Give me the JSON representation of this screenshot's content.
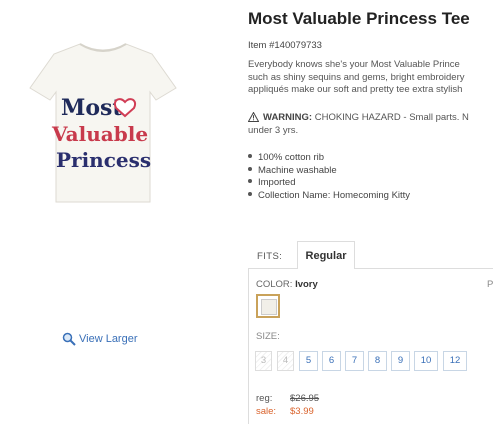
{
  "product": {
    "title": "Most Valuable Princess Tee",
    "item_number": "Item #140079733",
    "description_lines": [
      "Everybody knows she's your Most Valuable Prince",
      "such as shiny sequins and gems, bright embroidery",
      "appliqués make our soft and pretty tee extra stylish"
    ],
    "warning_label": "WARNING:",
    "warning_text": "CHOKING HAZARD - Small parts. N",
    "warning_text_2": "under 3 yrs.",
    "features": [
      "100% cotton rib",
      "Machine washable",
      "Imported",
      "Collection Name: Homecoming Kitty"
    ],
    "image_text": {
      "line1": "Most",
      "line2": "Valuable",
      "line3": "Princess"
    }
  },
  "view_larger": {
    "label": "View Larger",
    "icon": "magnifier-icon"
  },
  "fits": {
    "label": "FITS:",
    "tabs": [
      "Regular"
    ]
  },
  "color": {
    "label": "COLOR:",
    "value": "Ivory",
    "swatch_color": "#f1efe8",
    "cut_text": "P"
  },
  "size": {
    "label": "SIZE:",
    "options": [
      {
        "label": "3",
        "available": false
      },
      {
        "label": "4",
        "available": false
      },
      {
        "label": "5",
        "available": true
      },
      {
        "label": "6",
        "available": true
      },
      {
        "label": "7",
        "available": true
      },
      {
        "label": "8",
        "available": true
      },
      {
        "label": "9",
        "available": true
      },
      {
        "label": "10",
        "available": true
      },
      {
        "label": "12",
        "available": true
      }
    ]
  },
  "price": {
    "reg_label": "reg:",
    "reg_value": "$26.95",
    "sale_label": "sale:",
    "sale_value": "$3.99"
  },
  "colors": {
    "link": "#3a70b8",
    "sale": "#d9622b",
    "swatch_border": "#c9a25a"
  }
}
